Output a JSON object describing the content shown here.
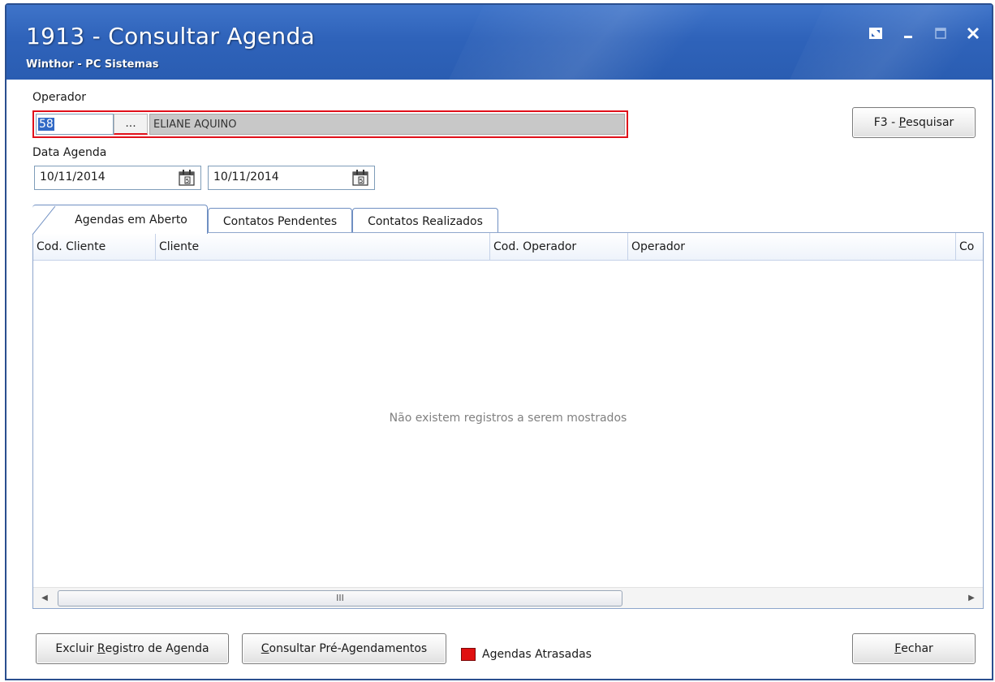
{
  "window": {
    "title": "1913 - Consultar Agenda",
    "subtitle": "Winthor - PC Sistemas",
    "controls": [
      "restore-icon",
      "minimize-icon",
      "maximize-icon",
      "close-icon"
    ]
  },
  "operator": {
    "label": "Operador",
    "code_value": "58",
    "lookup_label": "...",
    "name_value": "ELIANE AQUINO"
  },
  "search_button": {
    "prefix": "F3 - ",
    "accel": "P",
    "rest": "esquisar"
  },
  "date": {
    "label": "Data Agenda",
    "start": "10/11/2014",
    "end": "10/11/2014"
  },
  "tabs": [
    {
      "label": "Agendas em Aberto",
      "active": true
    },
    {
      "label": "Contatos Pendentes",
      "active": false
    },
    {
      "label": "Contatos Realizados",
      "active": false
    }
  ],
  "grid": {
    "columns": [
      "Cod. Cliente",
      "Cliente",
      "Cod. Operador",
      "Operador",
      "Co"
    ],
    "empty_message": "Não existem registros a serem mostrados",
    "scroll_grip": "III"
  },
  "footer": {
    "delete_button": {
      "pre": "Excluir ",
      "accel": "R",
      "rest": "egistro de Agenda"
    },
    "pre_schedule_button": {
      "accel": "C",
      "rest": "onsultar Pré-Agendamentos"
    },
    "legend_label": "Agendas Atrasadas",
    "close_button": {
      "accel": "F",
      "rest": "echar"
    }
  },
  "colors": {
    "title_bar": "#2f63ba",
    "highlight_border": "#e0101a",
    "legend_overdue": "#e01010",
    "selection": "#3169c6"
  }
}
